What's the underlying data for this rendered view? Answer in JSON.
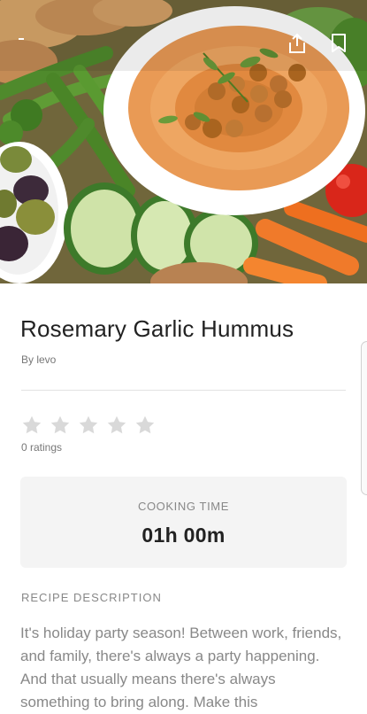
{
  "recipe": {
    "title": "Rosemary Garlic Hummus",
    "author": "By levo",
    "rating_count": "0 ratings",
    "star_count": 5
  },
  "cooking": {
    "label": "COOKING TIME",
    "value": "01h 00m"
  },
  "description": {
    "heading": "RECIPE DESCRIPTION",
    "text": "It's holiday party season! Between work, friends, and family, there's always a party happening. And that usually means there's always something to bring along. Make this"
  },
  "icons": {
    "back": "back-icon",
    "share": "share-icon",
    "bookmark": "bookmark-icon",
    "star": "star-icon"
  },
  "colors": {
    "star_empty": "#d9d9d9",
    "card_bg": "#f4f4f4",
    "title": "#222222",
    "muted": "#888888"
  }
}
